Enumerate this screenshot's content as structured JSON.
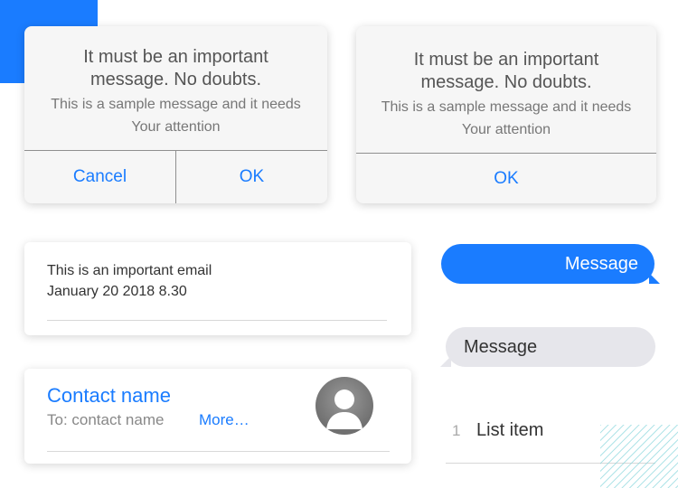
{
  "colors": {
    "accent": "#1a7cff",
    "alert_bg": "#f6f6f6",
    "incoming_bubble": "#e6e6eb",
    "stripe": "#87d6dc"
  },
  "alert_two_button": {
    "title": "It must be an important message. No doubts.",
    "message": "This is a sample message and it needs Your attention",
    "cancel_label": "Cancel",
    "ok_label": "OK"
  },
  "alert_one_button": {
    "title": "It must be an important message. No doubts.",
    "message": "This is a sample message and it needs Your attention",
    "ok_label": "OK"
  },
  "email_card": {
    "subject": "This is an important email",
    "date": "January 20 2018  8.30"
  },
  "contact_card": {
    "name": "Contact name",
    "to": "To: contact name",
    "more_label": "More…",
    "avatar_icon": "person-avatar-icon"
  },
  "messages": {
    "outgoing": "Message",
    "incoming": "Message"
  },
  "list": {
    "items": [
      {
        "number": "1",
        "label": "List item"
      }
    ]
  }
}
